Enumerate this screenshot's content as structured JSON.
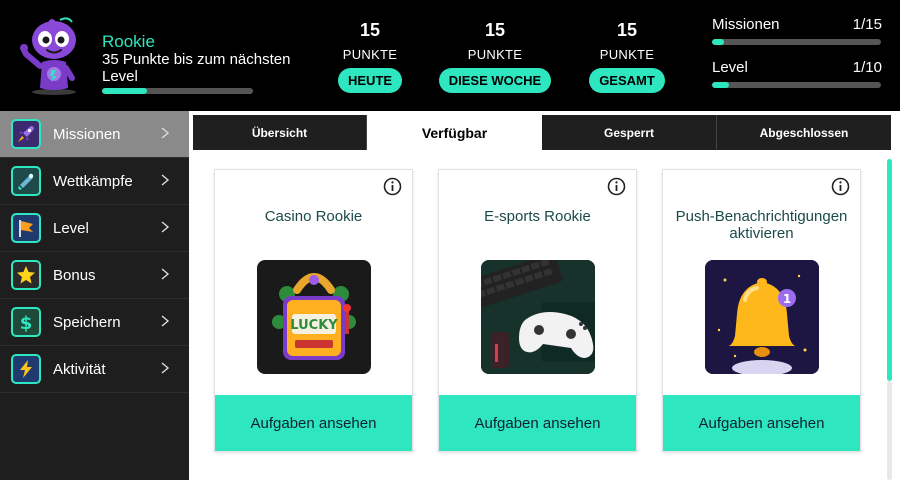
{
  "header": {
    "rank_title": "Rookie",
    "rank_subtitle": "35 Punkte bis zum nächsten Level",
    "rank_progress": 0.3
  },
  "stats": [
    {
      "value": "15",
      "label": "PUNKTE",
      "period": "HEUTE"
    },
    {
      "value": "15",
      "label": "PUNKTE",
      "period": "DIESE WOCHE"
    },
    {
      "value": "15",
      "label": "PUNKTE",
      "period": "GESAMT"
    }
  ],
  "progress": [
    {
      "label": "Missionen",
      "count": "1/15",
      "fraction": 0.067
    },
    {
      "label": "Level",
      "count": "1/10",
      "fraction": 0.1
    }
  ],
  "sidebar": {
    "items": [
      {
        "label": "Missionen",
        "icon": "rocket-icon",
        "active": true
      },
      {
        "label": "Wettkämpfe",
        "icon": "trophy-icon",
        "active": false
      },
      {
        "label": "Level",
        "icon": "flag-icon",
        "active": false
      },
      {
        "label": "Bonus",
        "icon": "star-icon",
        "active": false
      },
      {
        "label": "Speichern",
        "icon": "dollar-icon",
        "active": false
      },
      {
        "label": "Aktivität",
        "icon": "lightning-icon",
        "active": false
      }
    ]
  },
  "tabs": [
    {
      "label": "Übersicht",
      "active": false
    },
    {
      "label": "Verfügbar",
      "active": true
    },
    {
      "label": "Gesperrt",
      "active": false
    },
    {
      "label": "Abgeschlossen",
      "active": false
    }
  ],
  "cards": [
    {
      "title": "Casino Rookie",
      "image": "lucky-slot-machine-image",
      "button": "Aufgaben ansehen"
    },
    {
      "title": "E-sports Rookie",
      "image": "gaming-controller-keyboard-image",
      "button": "Aufgaben ansehen"
    },
    {
      "title": "Push-Benachrichtigungen aktivieren",
      "image": "notification-bell-image",
      "button": "Aufgaben ansehen",
      "badge": "1"
    }
  ],
  "colors": {
    "accent": "#2ee6c0",
    "header_bg": "#000000",
    "sidebar_bg": "#1e1e1e",
    "sidebar_active_bg": "#8a8a8a",
    "card_title": "#1b4a4a"
  }
}
